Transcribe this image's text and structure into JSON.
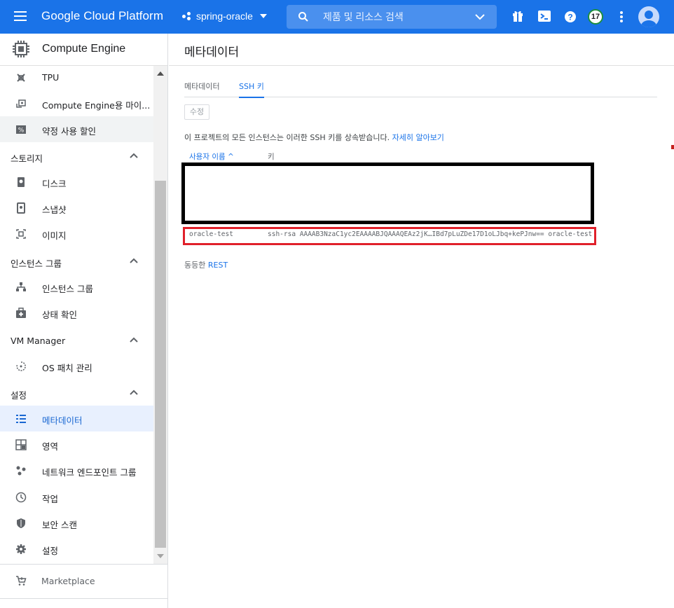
{
  "topbar": {
    "brand": "Google Cloud Platform",
    "project": "spring-oracle",
    "search_placeholder": "제품 및 리소스 검색",
    "notification_count": "17",
    "bar_color": "#1a73e8"
  },
  "icons": {
    "menu": "hamburger-icon",
    "search": "search-icon",
    "gift": "gift-icon",
    "shell": "cloud-shell-icon",
    "help": "help-icon",
    "more": "more-vert-icon",
    "account": "account-icon"
  },
  "sidebar": {
    "product": "Compute Engine",
    "items": [
      {
        "label": "TPU",
        "icon": "tpu-icon"
      },
      {
        "label": "Compute Engine용 마이...",
        "icon": "migrate-icon"
      },
      {
        "label": "약정 사용 할인",
        "icon": "percent-icon"
      }
    ],
    "sections": [
      {
        "label": "스토리지",
        "items": [
          {
            "label": "디스크",
            "icon": "disk-icon"
          },
          {
            "label": "스냅샷",
            "icon": "snapshot-icon"
          },
          {
            "label": "이미지",
            "icon": "image-icon"
          }
        ]
      },
      {
        "label": "인스턴스 그룹",
        "items": [
          {
            "label": "인스턴스 그룹",
            "icon": "instance-group-icon"
          },
          {
            "label": "상태 확인",
            "icon": "health-check-icon"
          }
        ]
      },
      {
        "label": "VM Manager",
        "items": [
          {
            "label": "OS 패치 관리",
            "icon": "os-patch-icon"
          }
        ]
      },
      {
        "label": "설정",
        "items": [
          {
            "label": "메타데이터",
            "icon": "metadata-icon"
          },
          {
            "label": "영역",
            "icon": "zones-icon"
          },
          {
            "label": "네트워크 엔드포인트 그룹",
            "icon": "network-endpoint-icon"
          },
          {
            "label": "작업",
            "icon": "operations-icon"
          },
          {
            "label": "보안 스캔",
            "icon": "security-scan-icon"
          },
          {
            "label": "설정",
            "icon": "settings-icon"
          }
        ]
      }
    ],
    "marketplace": "Marketplace",
    "active_color": "#1967d2"
  },
  "main": {
    "title": "메타데이터",
    "tabs": [
      {
        "label": "메타데이터"
      },
      {
        "label": "SSH 키"
      }
    ],
    "edit_label": "수정",
    "description": "이 프로젝트의 모든 인스턴스는 이러한 SSH 키를 상속받습니다.",
    "learn_more": "자세히 알아보기",
    "columns": {
      "user": "사용자 이름 ^",
      "key": "키"
    },
    "row": {
      "user": "oracle-test",
      "key": "ssh-rsa AAAAB3NzaC1yc2EAAAABJQAAAQEAz2jK…IBd7pLuZDe17D1oLJbq+kePJnw== oracle-test"
    },
    "equivalent_prefix": "동등한",
    "equivalent_link": "REST",
    "highlight_color": "#e0202a"
  }
}
